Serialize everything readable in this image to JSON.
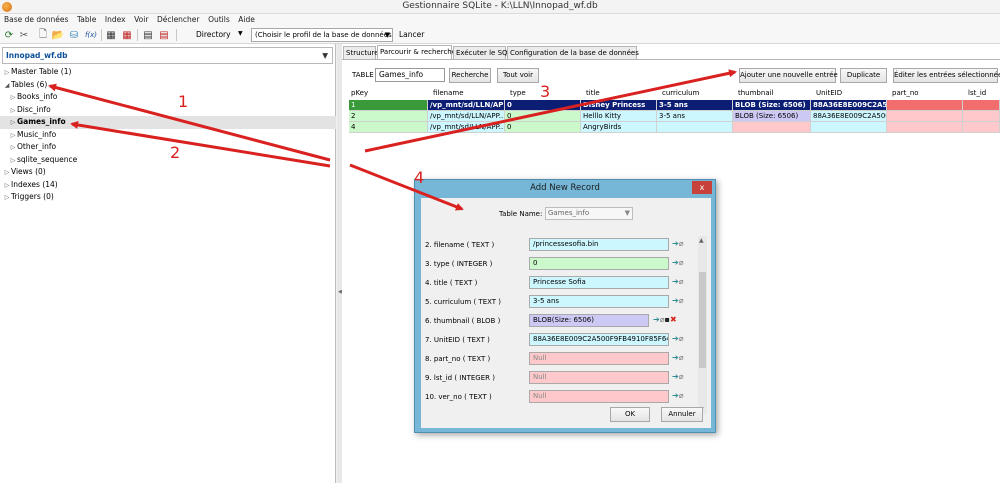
{
  "window": {
    "title": "Gestionnaire SQLite - K:\\LLN\\Innopad_wf.db"
  },
  "menu": [
    "Base de données",
    "Table",
    "Index",
    "Voir",
    "Déclencher",
    "Outils",
    "Aide"
  ],
  "toolbar": {
    "directory_label": "Directory",
    "profile_placeholder": "(Choisir le profil de la base de données)",
    "run_label": "Lancer",
    "func_label": "f(x)"
  },
  "left": {
    "database": "Innopad_wf.db",
    "tree": [
      {
        "label": "Master Table (1)",
        "level": 0,
        "expanded": false,
        "selected": false
      },
      {
        "label": "Tables (6)",
        "level": 0,
        "expanded": true,
        "selected": false
      },
      {
        "label": "Books_info",
        "level": 1,
        "expanded": false,
        "selected": false
      },
      {
        "label": "Disc_info",
        "level": 1,
        "expanded": false,
        "selected": false
      },
      {
        "label": "Games_info",
        "level": 1,
        "expanded": false,
        "selected": true
      },
      {
        "label": "Music_info",
        "level": 1,
        "expanded": false,
        "selected": false
      },
      {
        "label": "Other_info",
        "level": 1,
        "expanded": false,
        "selected": false
      },
      {
        "label": "sqlite_sequence",
        "level": 1,
        "expanded": false,
        "selected": false
      },
      {
        "label": "Views (0)",
        "level": 0,
        "expanded": false,
        "selected": false
      },
      {
        "label": "Indexes (14)",
        "level": 0,
        "expanded": false,
        "selected": false
      },
      {
        "label": "Triggers (0)",
        "level": 0,
        "expanded": false,
        "selected": false
      }
    ]
  },
  "tabs": [
    "Structure",
    "Parcourir & rechercher",
    "Exécuter le SQL",
    "Configuration de la base de données"
  ],
  "browse": {
    "table_label": "TABLE",
    "table_name": "Games_info",
    "search_button": "Recherche",
    "view_all_button": "Tout voir",
    "add_button": "Ajouter une nouvelle entrée",
    "duplicate_button": "Duplicate",
    "edit_button": "Éditer les entrées sélectionnées",
    "columns": [
      "pKey",
      "filename",
      "type",
      "title",
      "curriculum",
      "thumbnail",
      "UnitEID",
      "part_no",
      "lst_id"
    ],
    "rows": [
      [
        "1",
        "/vp_mnt/sd/LLN/APP...",
        "0",
        "Disney Princess",
        "3-5 ans",
        "BLOB (Size: 6506)",
        "88A36E8E009C2A50...",
        "",
        ""
      ],
      [
        "2",
        "/vp_mnt/sd/LLN/APP...",
        "0",
        "Helllo Kitty",
        "3-5 ans",
        "BLOB (Size: 6506)",
        "88A36E8E009C2A500F...",
        "",
        ""
      ],
      [
        "4",
        "/vp_mnt/sd/LLN/APP...",
        "0",
        "AngryBirds",
        "",
        "",
        "",
        "",
        ""
      ]
    ]
  },
  "dialog": {
    "title": "Add New Record",
    "close_label": "x",
    "table_name_label": "Table Name:",
    "table_name_value": "Games_info",
    "fields": [
      {
        "label": "2. filename ( TEXT )",
        "value": "/princessesofia.bin",
        "kind": "text"
      },
      {
        "label": "3. type ( INTEGER )",
        "value": "0",
        "kind": "int"
      },
      {
        "label": "4. title ( TEXT )",
        "value": "Princesse Sofia",
        "kind": "text"
      },
      {
        "label": "5. curriculum ( TEXT )",
        "value": "3-5 ans",
        "kind": "text"
      },
      {
        "label": "6. thumbnail ( BLOB )",
        "value": "BLOB(Size: 6506)",
        "kind": "blob"
      },
      {
        "label": "7. UnitEID ( TEXT )",
        "value": "88A36E8E009C2A500F9FB4910F85F646",
        "kind": "text"
      },
      {
        "label": "8. part_no ( TEXT )",
        "value": "Null",
        "kind": "null"
      },
      {
        "label": "9. lst_id ( INTEGER )",
        "value": "Null",
        "kind": "null"
      },
      {
        "label": "10. ver_no ( TEXT )",
        "value": "Null",
        "kind": "null"
      }
    ],
    "ok_label": "OK",
    "cancel_label": "Annuler"
  },
  "annotations": [
    "1",
    "2",
    "3",
    "4"
  ],
  "colors": {
    "annotation": "#d9211f",
    "selected_row": "#0b1e74",
    "pkey_selected": "#3a9a3a",
    "text_cell": "#ccf7ff",
    "int_cell": "#ccf9cc",
    "blob_cell": "#cdc9f5",
    "null_cell": "#ffc9cb"
  }
}
